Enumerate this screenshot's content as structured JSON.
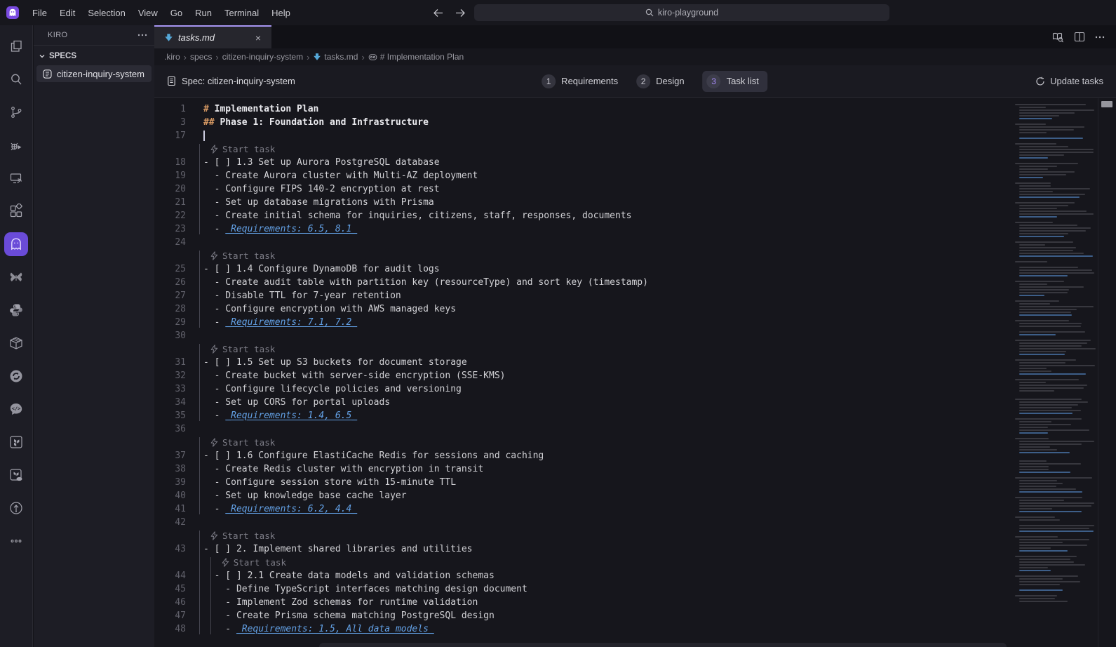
{
  "window": {
    "menus": [
      "File",
      "Edit",
      "Selection",
      "View",
      "Go",
      "Run",
      "Terminal",
      "Help"
    ],
    "search_value": "kiro-playground"
  },
  "activity_bar": {
    "icons": [
      {
        "name": "explorer-icon"
      },
      {
        "name": "search-icon"
      },
      {
        "name": "source-control-icon"
      },
      {
        "name": "run-debug-icon"
      },
      {
        "name": "remote-explorer-icon"
      },
      {
        "name": "extensions-icon"
      },
      {
        "name": "kiro-ghost-icon",
        "active": true
      },
      {
        "name": "butterfly-icon"
      },
      {
        "name": "python-icon"
      },
      {
        "name": "container-icon"
      },
      {
        "name": "sync-icon"
      },
      {
        "name": "code-chat-icon"
      },
      {
        "name": "terraform-icon"
      },
      {
        "name": "terraform-cloud-icon"
      },
      {
        "name": "git-arrow-icon"
      },
      {
        "name": "more-icon"
      }
    ]
  },
  "sidebar": {
    "title": "KIRO",
    "section": "SPECS",
    "items": [
      {
        "label": "citizen-inquiry-system",
        "selected": true
      }
    ]
  },
  "editor": {
    "tab": {
      "name": "tasks.md"
    },
    "breadcrumb": [
      {
        "label": ".kiro"
      },
      {
        "label": "specs"
      },
      {
        "label": "citizen-inquiry-system"
      },
      {
        "label": "tasks.md",
        "icon": "markdown-icon"
      },
      {
        "label": "# Implementation Plan",
        "icon": "symbol-icon"
      }
    ],
    "spec_bar": {
      "label": "Spec: citizen-inquiry-system",
      "steps": [
        {
          "num": "1",
          "label": "Requirements",
          "active": false
        },
        {
          "num": "2",
          "label": "Design",
          "active": false
        },
        {
          "num": "3",
          "label": "Task list",
          "active": true
        }
      ],
      "action_label": "Update tasks"
    },
    "lens_label": "Start task",
    "lines": [
      {
        "n": 1,
        "kind": "h1",
        "text": "# Implementation Plan"
      },
      {
        "n": 3,
        "kind": "h2",
        "text": "## Phase 1: Foundation and Infrastructure"
      },
      {
        "n": 17,
        "kind": "empty",
        "cursor": true
      },
      {
        "kind": "lens",
        "level": 0
      },
      {
        "n": 18,
        "kind": "task",
        "text": "- [ ] 1.3 Set up Aurora PostgreSQL database"
      },
      {
        "n": 19,
        "kind": "item",
        "text": "  - Create Aurora cluster with Multi-AZ deployment"
      },
      {
        "n": 20,
        "kind": "item",
        "text": "  - Configure FIPS 140-2 encryption at rest"
      },
      {
        "n": 21,
        "kind": "item",
        "text": "  - Set up database migrations with Prisma"
      },
      {
        "n": 22,
        "kind": "item",
        "text": "  - Create initial schema for inquiries, citizens, staff, responses, documents"
      },
      {
        "n": 23,
        "kind": "req",
        "prefix": "  - ",
        "em": "_Requirements: 6.5, 8.1_"
      },
      {
        "n": 24,
        "kind": "empty"
      },
      {
        "kind": "lens",
        "level": 0
      },
      {
        "n": 25,
        "kind": "task",
        "text": "- [ ] 1.4 Configure DynamoDB for audit logs"
      },
      {
        "n": 26,
        "kind": "item",
        "text": "  - Create audit table with partition key (resourceType) and sort key (timestamp)"
      },
      {
        "n": 27,
        "kind": "item",
        "text": "  - Disable TTL for 7-year retention"
      },
      {
        "n": 28,
        "kind": "item",
        "text": "  - Configure encryption with AWS managed keys"
      },
      {
        "n": 29,
        "kind": "req",
        "prefix": "  - ",
        "em": "_Requirements: 7.1, 7.2_"
      },
      {
        "n": 30,
        "kind": "empty"
      },
      {
        "kind": "lens",
        "level": 0
      },
      {
        "n": 31,
        "kind": "task",
        "text": "- [ ] 1.5 Set up S3 buckets for document storage"
      },
      {
        "n": 32,
        "kind": "item",
        "text": "  - Create bucket with server-side encryption (SSE-KMS)"
      },
      {
        "n": 33,
        "kind": "item",
        "text": "  - Configure lifecycle policies and versioning"
      },
      {
        "n": 34,
        "kind": "item",
        "text": "  - Set up CORS for portal uploads"
      },
      {
        "n": 35,
        "kind": "req",
        "prefix": "  - ",
        "em": "_Requirements: 1.4, 6.5_"
      },
      {
        "n": 36,
        "kind": "empty"
      },
      {
        "kind": "lens",
        "level": 0
      },
      {
        "n": 37,
        "kind": "task",
        "text": "- [ ] 1.6 Configure ElastiCache Redis for sessions and caching"
      },
      {
        "n": 38,
        "kind": "item",
        "text": "  - Create Redis cluster with encryption in transit"
      },
      {
        "n": 39,
        "kind": "item",
        "text": "  - Configure session store with 15-minute TTL"
      },
      {
        "n": 40,
        "kind": "item",
        "text": "  - Set up knowledge base cache layer"
      },
      {
        "n": 41,
        "kind": "req",
        "prefix": "  - ",
        "em": "_Requirements: 6.2, 4.4_"
      },
      {
        "n": 42,
        "kind": "empty"
      },
      {
        "kind": "lens",
        "level": 0
      },
      {
        "n": 43,
        "kind": "task",
        "text": "- [ ] 2. Implement shared libraries and utilities"
      },
      {
        "kind": "lens",
        "level": 1
      },
      {
        "n": 44,
        "kind": "task",
        "text": "  - [ ] 2.1 Create data models and validation schemas"
      },
      {
        "n": 45,
        "kind": "item",
        "text": "    - Define TypeScript interfaces matching design document"
      },
      {
        "n": 46,
        "kind": "item",
        "text": "    - Implement Zod schemas for runtime validation"
      },
      {
        "n": 47,
        "kind": "item",
        "text": "    - Create Prisma schema matching PostgreSQL design"
      },
      {
        "n": 48,
        "kind": "req",
        "prefix": "    - ",
        "em": "_Requirements: 1.5, All data models_"
      }
    ]
  },
  "colors": {
    "accent_purple": "#7a4be0",
    "step_active_purple": "#a78bfa",
    "heading_orange": "#d79963",
    "requirements_blue": "#63a1e6",
    "markdown_blue": "#55a8d8",
    "tab_active_border": "#a796f2"
  }
}
